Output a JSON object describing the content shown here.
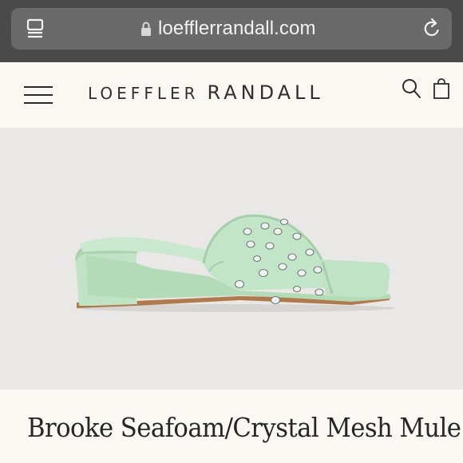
{
  "browser": {
    "url": "loefflerrandall.com",
    "icons": {
      "tabs": "tabs-icon",
      "lock": "lock-icon",
      "reload": "reload-icon"
    }
  },
  "header": {
    "logo_part1": "LOEFFLER",
    "logo_part2": "RANDALL",
    "icons": {
      "menu": "menu-icon",
      "search": "search-icon",
      "bag": "shopping-bag-icon"
    }
  },
  "product": {
    "title": "Brooke Seafoam/Crystal Mesh Mule",
    "image_alt": "product-image"
  },
  "colors": {
    "browser_bar": "#4a4a4a",
    "page_background": "#fbf8f3",
    "image_background": "#e9e8e7",
    "shoe_color": "#bfe3c4",
    "sole_color": "#b07a4e"
  }
}
